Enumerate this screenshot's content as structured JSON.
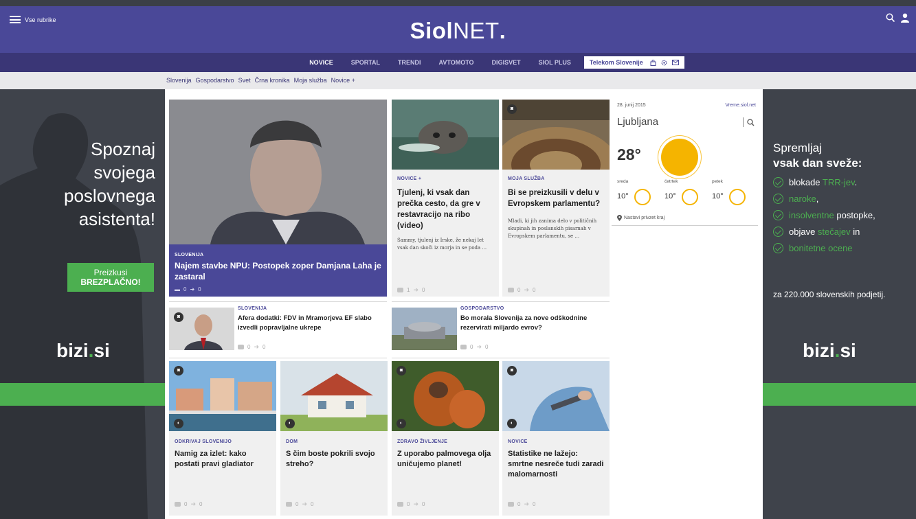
{
  "header": {
    "menu_label": "Vse rubrike",
    "logo_bold": "Siol",
    "logo_light": "NET",
    "logo_dot": ".",
    "icons": [
      "search-icon",
      "user-icon"
    ]
  },
  "nav": {
    "items": [
      "NOVICE",
      "SPORTAL",
      "TRENDI",
      "AVTOMOTO",
      "DIGISVET",
      "SIOL PLUS"
    ],
    "active": "NOVICE",
    "telekom_label": "Telekom Slovenije",
    "telekom_icons": [
      "bag-icon",
      "settings-icon",
      "mail-icon"
    ]
  },
  "subnav": {
    "items": [
      "Slovenija",
      "Gospodarstvo",
      "Svet",
      "Črna kronika",
      "Moja služba",
      "Novice +"
    ]
  },
  "ad_left": {
    "headline_lines": [
      "Spoznaj",
      "svojega"
    ],
    "headline_bold": [
      "poslovnega",
      "asistenta!"
    ],
    "cta_line1": "Preizkusi",
    "cta_line2": "BREZPLAČNO!",
    "brand_main": "bizi",
    "brand_dot": ".",
    "brand_tld": "si"
  },
  "ad_right": {
    "head_line1": "Spremljaj",
    "head_line2": "vsak dan sveže:",
    "items": [
      {
        "pre": "blokade ",
        "green": "TRR-jev",
        "post": "."
      },
      {
        "pre": "",
        "green": "naroke",
        "post": ","
      },
      {
        "pre": "",
        "green": "insolventne",
        "post": " postopke,"
      },
      {
        "pre": "objave ",
        "green": "stečajev",
        "post": " in"
      },
      {
        "pre": "",
        "green": "bonitetne ocene",
        "post": ""
      }
    ],
    "footer": "za 220.000 slovenskih podjetij.",
    "brand_main": "bizi",
    "brand_dot": ".",
    "brand_tld": "si"
  },
  "hero": {
    "category": "SLOVENIJA",
    "title": "Najem stavbe NPU: Postopek zoper Damjana Laha je zastaral",
    "comments": "0",
    "shares": "0"
  },
  "cards": [
    {
      "category": "NOVICE +",
      "title": "Tjulenj, ki vsak dan prečka cesto, da gre v restavracijo na ribo (video)",
      "excerpt": "Sammy, tjulenj iz Irske, že nekaj let vsak dan skoči iz morja in se poda ...",
      "comments": "1",
      "shares": "0"
    },
    {
      "category": "MOJA SLUŽBA",
      "title": "Bi se preizkusili v delu v Evropskem parlamentu?",
      "excerpt": "Mladi, ki jih zanima delo v političnih skupinah in poslanskih pisarnah v Evropskem parlamentu, se ...",
      "comments": "0",
      "shares": "0"
    }
  ],
  "row2": [
    {
      "category": "SLOVENIJA",
      "title": "Afera dodatki: FDV in Mramorjeva EF slabo izvedli popravljalne ukrepe",
      "comments": "0",
      "shares": "0"
    },
    {
      "category": "GOSPODARSTVO",
      "title": "Bo morala Slovenija za nove odškodnine rezervirati miljardo evrov?",
      "comments": "0",
      "shares": "0"
    }
  ],
  "tiles": [
    {
      "category": "ODKRIVAJ SLOVENIJO",
      "title": "Namig za izlet: kako postati pravi gladiator",
      "comments": "0",
      "shares": "0"
    },
    {
      "category": "DOM",
      "title": "S čim boste pokrili svojo streho?",
      "comments": "0",
      "shares": "0"
    },
    {
      "category": "ZDRAVO ŽIVLJENJE",
      "title": "Z uporabo palmovega olja uničujemo planet!",
      "comments": "0",
      "shares": "0"
    },
    {
      "category": "NOVICE",
      "title": "Statistike ne lažejo: smrtne nesreče tudi zaradi malomarnosti",
      "comments": "0",
      "shares": "0"
    }
  ],
  "weather": {
    "date": "28. junij 2015",
    "link": "Vreme.siol.net",
    "city": "Ljubljana",
    "temp": "28°",
    "days": [
      {
        "name": "sreda",
        "temp": "10°"
      },
      {
        "name": "četrtek",
        "temp": "10°"
      },
      {
        "name": "petek",
        "temp": "10°"
      }
    ],
    "set_location": "Nastavi privzet kraj"
  },
  "colors": {
    "brand": "#4a4898",
    "nav_dark": "#3a3676",
    "accent_green": "#4caf50",
    "sun": "#f5b400"
  }
}
